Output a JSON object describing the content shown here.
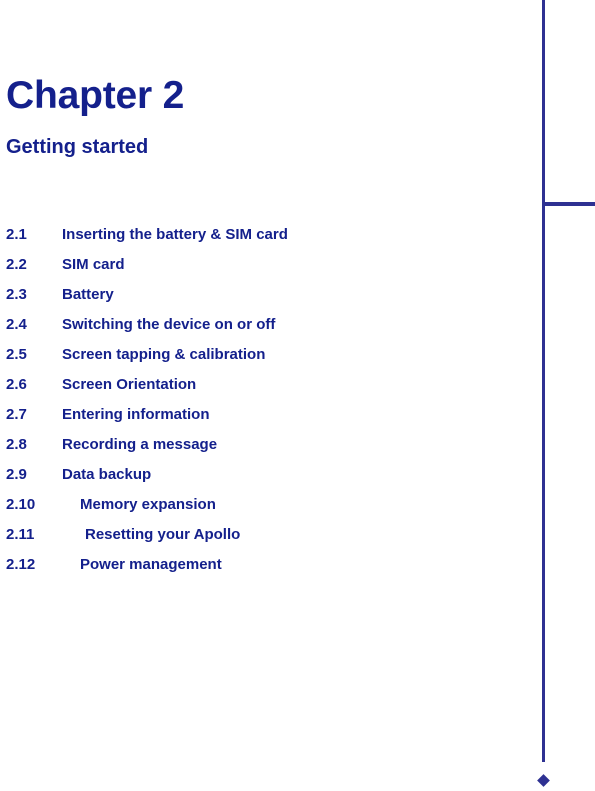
{
  "document": {
    "chapter_title": "Chapter 2",
    "chapter_subtitle": "Getting started"
  },
  "colors": {
    "text_navy": "#14208c",
    "rule_blue": "#2e3192",
    "page_background": "#ffffff"
  },
  "toc": {
    "entries": [
      {
        "number": "2.1",
        "label": "Inserting the battery & SIM card",
        "indent": 62
      },
      {
        "number": "2.2",
        "label": "SIM card",
        "indent": 62
      },
      {
        "number": "2.3",
        "label": "Battery",
        "indent": 62
      },
      {
        "number": "2.4",
        "label": "Switching the device on or off",
        "indent": 62
      },
      {
        "number": "2.5",
        "label": "Screen tapping & calibration",
        "indent": 62
      },
      {
        "number": "2.6",
        "label": "Screen Orientation",
        "indent": 62
      },
      {
        "number": "2.7",
        "label": "Entering information",
        "indent": 62
      },
      {
        "number": "2.8",
        "label": "Recording a message",
        "indent": 62
      },
      {
        "number": "2.9",
        "label": "Data backup",
        "indent": 62
      },
      {
        "number": "2.10",
        "label": "Memory expansion",
        "indent": 80
      },
      {
        "number": "2.11",
        "label": "Resetting your Apollo",
        "indent": 85
      },
      {
        "number": "2.12",
        "label": "Power management",
        "indent": 80
      }
    ]
  },
  "ornaments": {
    "vertical_rule": "vertical-rule",
    "horizontal_tick": "horizontal-rule",
    "diamond_marker": "diamond-ornament"
  }
}
